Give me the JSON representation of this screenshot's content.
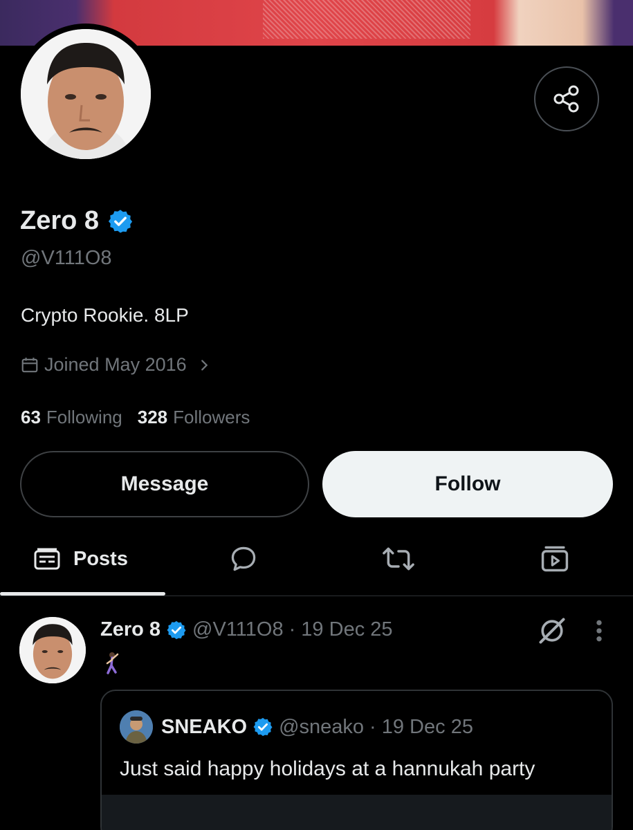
{
  "profile": {
    "display_name": "Zero 8",
    "handle": "@V111O8",
    "bio": "Crypto Rookie. 8LP",
    "joined": "Joined May 2016",
    "following_count": "63",
    "following_label": "Following",
    "followers_count": "328",
    "followers_label": "Followers",
    "verified": true
  },
  "actions": {
    "message_label": "Message",
    "follow_label": "Follow"
  },
  "tabs": [
    {
      "label": "Posts",
      "icon": "posts-icon",
      "active": true
    },
    {
      "label": "",
      "icon": "replies-icon",
      "active": false
    },
    {
      "label": "",
      "icon": "reposts-icon",
      "active": false
    },
    {
      "label": "",
      "icon": "media-icon",
      "active": false
    }
  ],
  "post": {
    "name": "Zero 8",
    "handle": "@V111O8",
    "date": "· 19 Dec 25",
    "emoji": "🕺",
    "quote": {
      "name": "SNEAKO",
      "handle": "@sneako",
      "date": "· 19 Dec 25",
      "text": "Just said happy holidays at a hannukah party"
    }
  },
  "colors": {
    "background": "#000000",
    "verified_blue": "#1d9bf0",
    "follow_button": "#eff3f4",
    "secondary_text": "#71767b"
  }
}
